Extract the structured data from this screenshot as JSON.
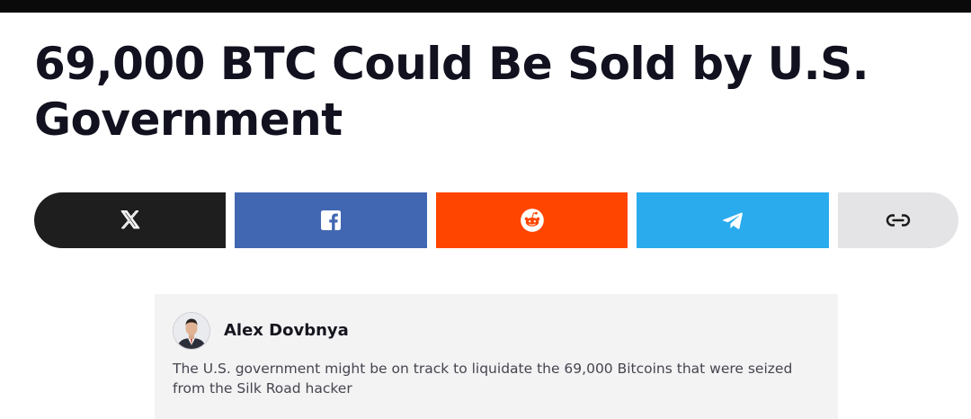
{
  "article": {
    "headline": "69,000 BTC Could Be Sold by U.S. Government"
  },
  "share": {
    "buttons": [
      {
        "network": "X",
        "icon": "x-logo-icon",
        "color": "#1e1e1e"
      },
      {
        "network": "Facebook",
        "icon": "facebook-icon",
        "color": "#4267b2"
      },
      {
        "network": "Reddit",
        "icon": "reddit-icon",
        "color": "#ff4500"
      },
      {
        "network": "Telegram",
        "icon": "telegram-icon",
        "color": "#2aabee"
      },
      {
        "network": "Copy link",
        "icon": "link-icon",
        "color": "#e4e4e6"
      }
    ]
  },
  "author": {
    "name": "Alex Dovbnya",
    "summary": "The U.S. government might be on track to liquidate the 69,000 Bitcoins that were seized from the Silk Road hacker"
  }
}
